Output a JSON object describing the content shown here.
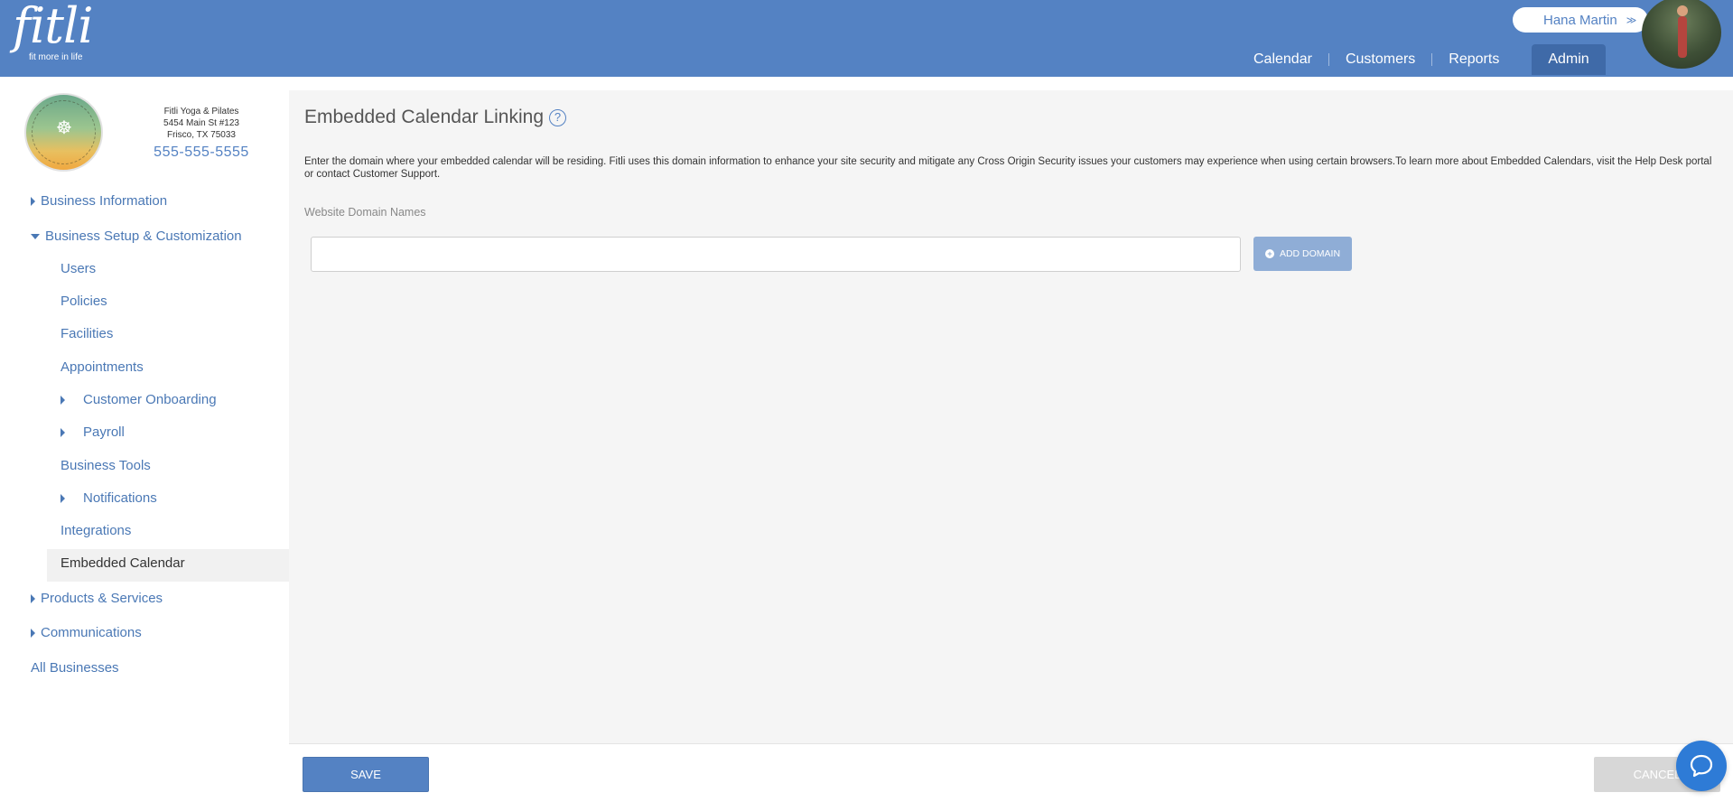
{
  "brand": {
    "name": "fitli",
    "tagline": "fit more in life"
  },
  "header": {
    "user_name": "Hana Martin",
    "user_chevron": "≫",
    "nav": [
      {
        "label": "Calendar"
      },
      {
        "label": "Customers"
      },
      {
        "label": "Reports"
      },
      {
        "label": "Admin",
        "active": true
      }
    ]
  },
  "business": {
    "name": "Fitli Yoga & Pilates",
    "address1": "5454 Main St #123",
    "address2": "Frisco, TX 75033",
    "phone": "555-555-5555"
  },
  "sidebar": {
    "items": [
      {
        "label": "Business Information"
      },
      {
        "label": "Business Setup & Customization"
      },
      {
        "label": "Users"
      },
      {
        "label": "Policies"
      },
      {
        "label": "Facilities"
      },
      {
        "label": "Appointments"
      },
      {
        "label": "Customer Onboarding"
      },
      {
        "label": "Payroll"
      },
      {
        "label": "Business Tools"
      },
      {
        "label": "Notifications"
      },
      {
        "label": "Integrations"
      },
      {
        "label": "Embedded Calendar"
      },
      {
        "label": "Products & Services"
      },
      {
        "label": "Communications"
      },
      {
        "label": "All Businesses"
      }
    ]
  },
  "main": {
    "title": "Embedded Calendar Linking",
    "help_symbol": "?",
    "description": "Enter the domain where your embedded calendar will be residing. Fitli uses this domain information to enhance your site security and mitigate any Cross Origin Security issues your customers may experience when using certain browsers.To learn more about Embedded Calendars, visit the Help Desk portal or contact Customer Support.",
    "field_label": "Website Domain Names",
    "domain_value": "",
    "add_button": "ADD DOMAIN"
  },
  "footer": {
    "save": "SAVE",
    "cancel": "CANCEL"
  },
  "colors": {
    "header": "#5482c3",
    "accent": "#4a78b5",
    "active_nav": "#3f6aa8",
    "chat": "#2e7bd6"
  },
  "icons": {
    "help": "question-circle-icon",
    "add": "plus-circle-icon",
    "chat": "chat-bubble-icon",
    "caret_right": "caret-right-icon",
    "caret_down": "caret-down-icon"
  }
}
